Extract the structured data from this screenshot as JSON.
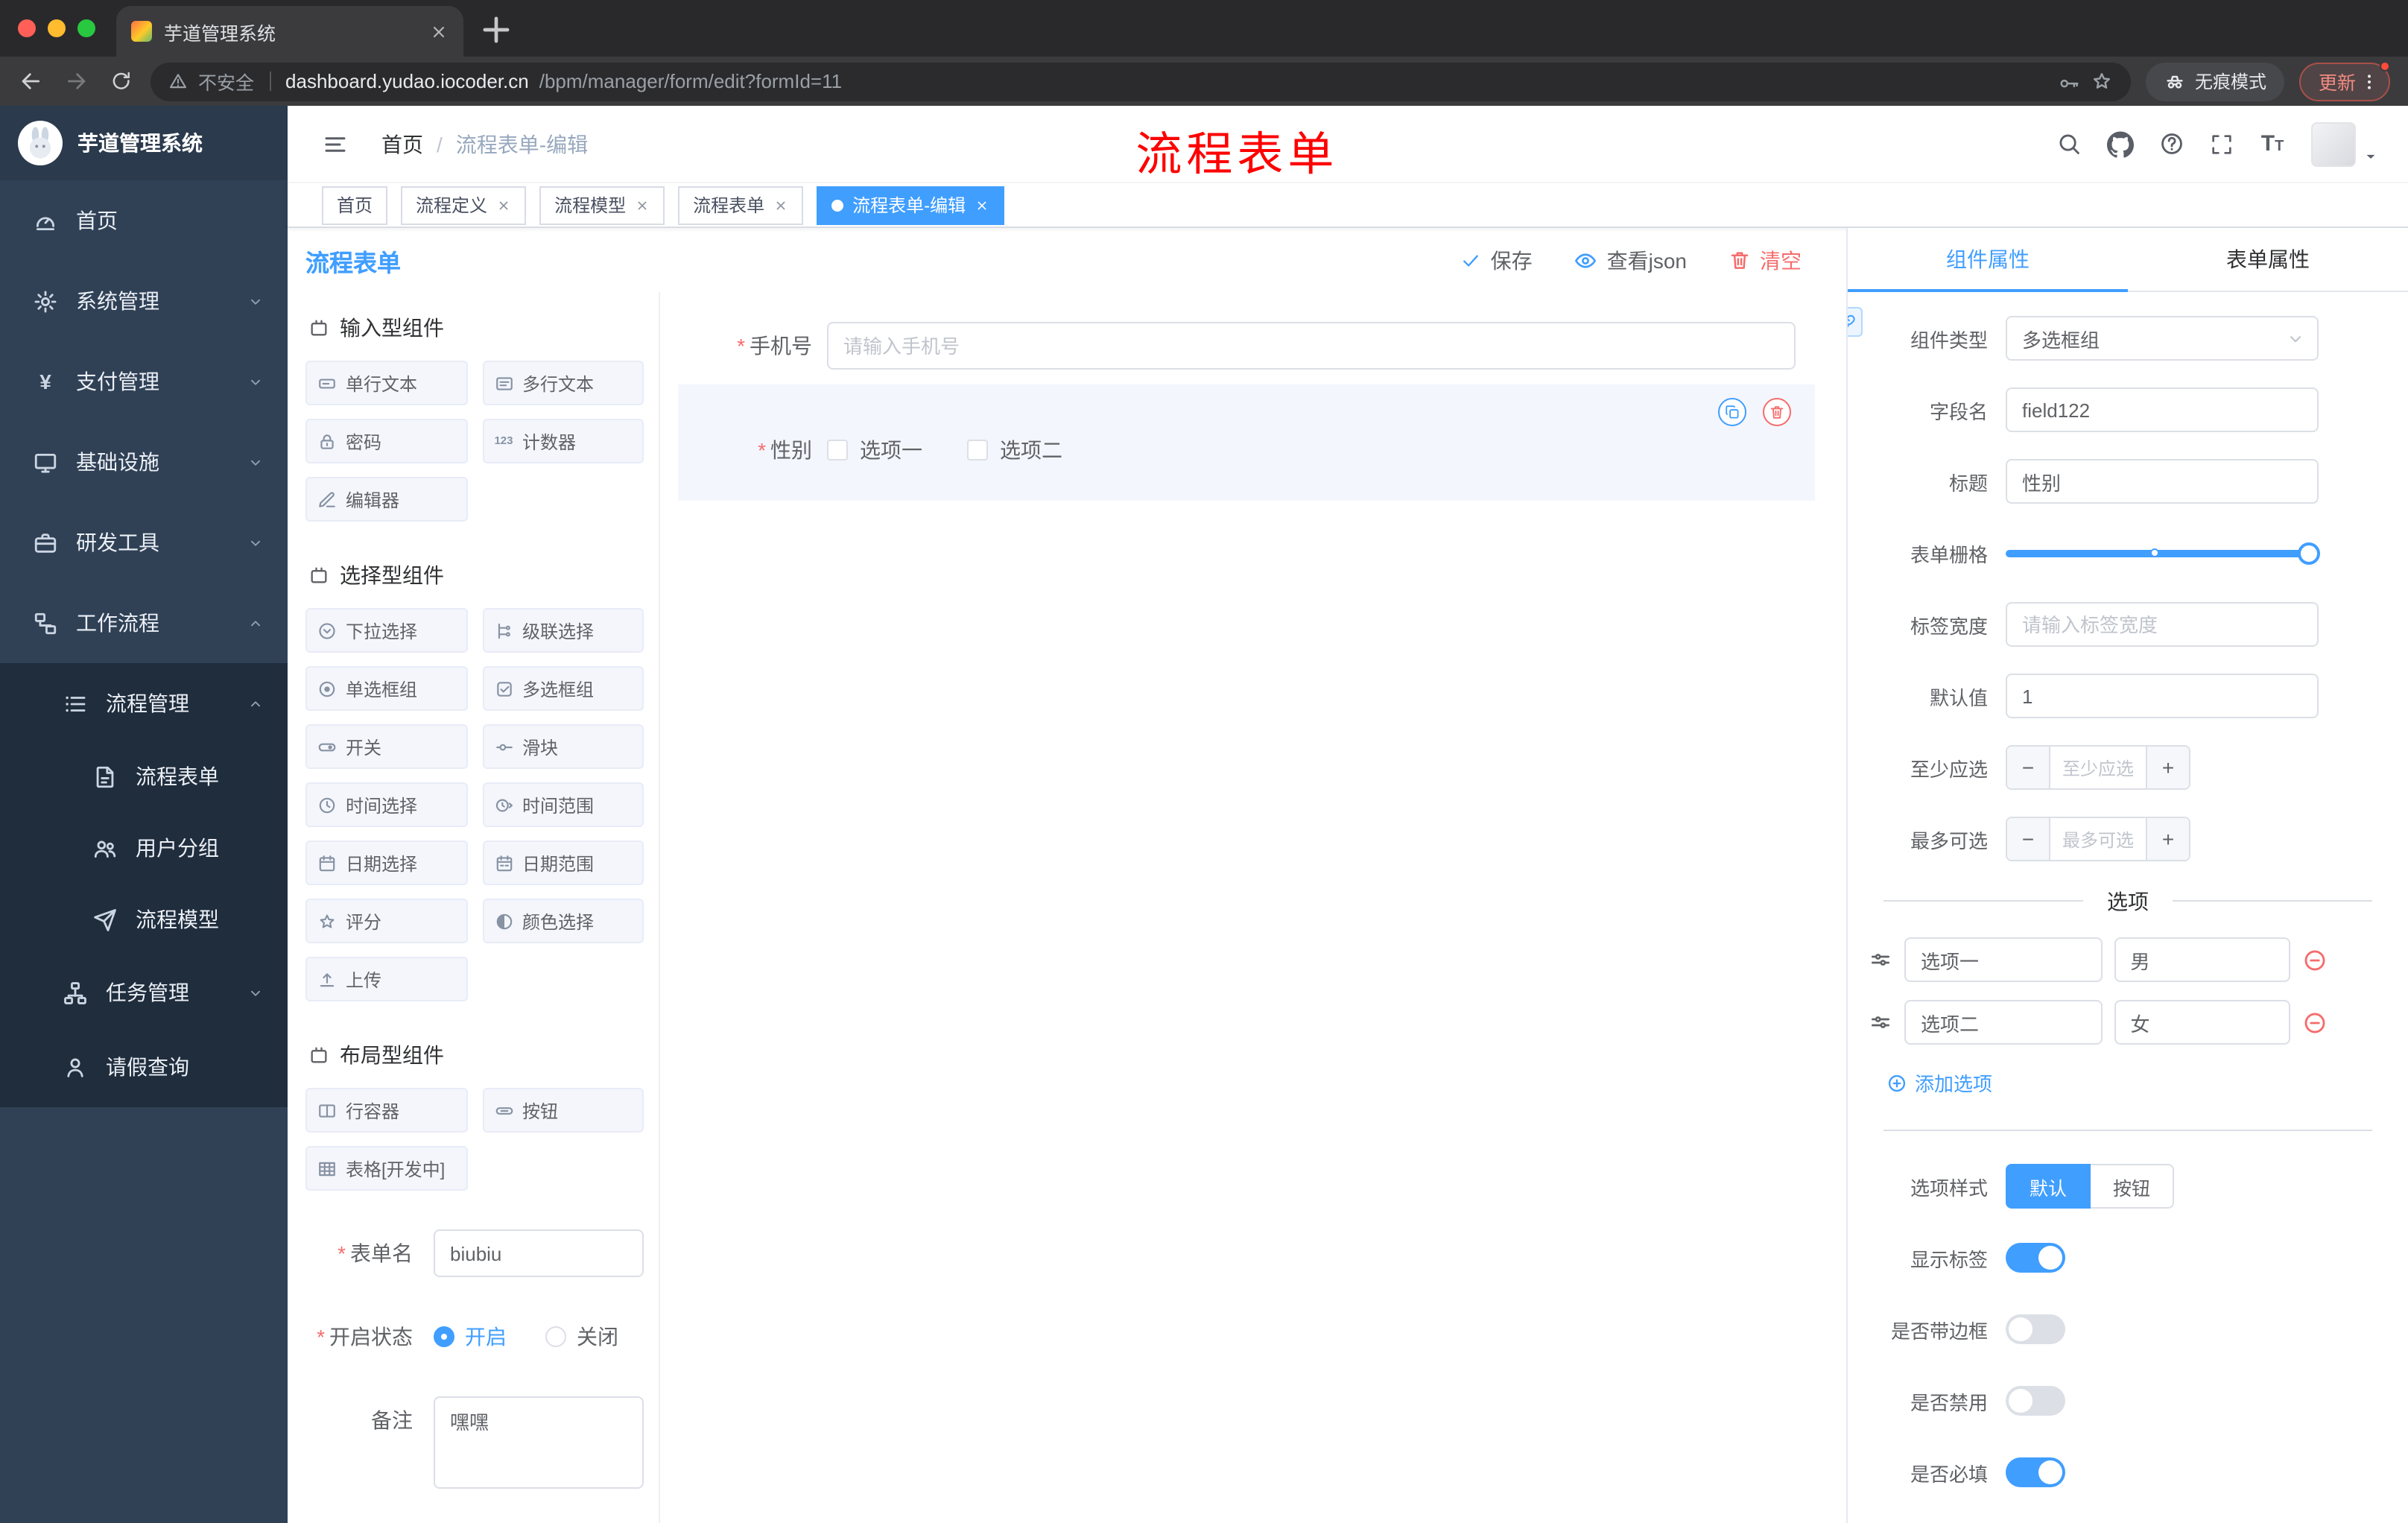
{
  "browser": {
    "tab_title": "芋道管理系统",
    "security_label": "不安全",
    "url_domain": "dashboard.yudao.iocoder.cn",
    "url_path": "/bpm/manager/form/edit?formId=11",
    "incognito_label": "无痕模式",
    "update_label": "更新"
  },
  "sidebar": {
    "logo_title": "芋道管理系统",
    "items": [
      {
        "label": "首页",
        "icon": "dashboard"
      },
      {
        "label": "系统管理",
        "icon": "gear"
      },
      {
        "label": "支付管理",
        "icon": "yen"
      },
      {
        "label": "基础设施",
        "icon": "monitor"
      },
      {
        "label": "研发工具",
        "icon": "toolbox"
      },
      {
        "label": "工作流程",
        "icon": "workflow"
      }
    ],
    "workflow": {
      "process_mgmt": {
        "label": "流程管理",
        "icon": "list"
      },
      "children": [
        {
          "label": "流程表单",
          "icon": "form"
        },
        {
          "label": "用户分组",
          "icon": "users"
        },
        {
          "label": "流程模型",
          "icon": "plane"
        }
      ],
      "task_mgmt": {
        "label": "任务管理",
        "icon": "sitemap"
      },
      "leave_query": {
        "label": "请假查询",
        "icon": "person"
      }
    }
  },
  "navbar": {
    "breadcrumb_home": "首页",
    "breadcrumb_current": "流程表单-编辑",
    "annotation": "流程表单"
  },
  "tags": [
    {
      "label": "首页"
    },
    {
      "label": "流程定义"
    },
    {
      "label": "流程模型"
    },
    {
      "label": "流程表单"
    },
    {
      "label": "流程表单-编辑"
    }
  ],
  "editor": {
    "title": "流程表单",
    "save": "保存",
    "view_json": "查看json",
    "clear": "清空",
    "palette": {
      "groups": [
        {
          "title": "输入型组件",
          "icon": "component-icon",
          "items": [
            {
              "label": "单行文本",
              "icon": "text-field"
            },
            {
              "label": "多行文本",
              "icon": "textarea"
            },
            {
              "label": "密码",
              "icon": "lock"
            },
            {
              "label": "计数器",
              "icon": "counter"
            },
            {
              "label": "编辑器",
              "icon": "editor"
            }
          ]
        },
        {
          "title": "选择型组件",
          "icon": "component-icon",
          "items": [
            {
              "label": "下拉选择",
              "icon": "select"
            },
            {
              "label": "级联选择",
              "icon": "cascader"
            },
            {
              "label": "单选框组",
              "icon": "radio"
            },
            {
              "label": "多选框组",
              "icon": "checkbox"
            },
            {
              "label": "开关",
              "icon": "switch"
            },
            {
              "label": "滑块",
              "icon": "slider"
            },
            {
              "label": "时间选择",
              "icon": "time"
            },
            {
              "label": "时间范围",
              "icon": "time-range"
            },
            {
              "label": "日期选择",
              "icon": "date"
            },
            {
              "label": "日期范围",
              "icon": "date-range"
            },
            {
              "label": "评分",
              "icon": "rate"
            },
            {
              "label": "颜色选择",
              "icon": "color"
            },
            {
              "label": "上传",
              "icon": "upload"
            }
          ]
        },
        {
          "title": "布局型组件",
          "icon": "component-icon",
          "items": [
            {
              "label": "行容器",
              "icon": "row"
            },
            {
              "label": "按钮",
              "icon": "button"
            },
            {
              "label": "表格[开发中]",
              "icon": "table"
            }
          ]
        }
      ]
    },
    "meta": {
      "name_label": "表单名",
      "name_value": "biubiu",
      "status_label": "开启状态",
      "status_on": "开启",
      "status_off": "关闭",
      "remark_label": "备注",
      "remark_value": "嘿嘿"
    },
    "canvas": {
      "phone_label": "手机号",
      "phone_placeholder": "请输入手机号",
      "gender_label": "性别",
      "gender_opt1": "选项一",
      "gender_opt2": "选项二"
    }
  },
  "props": {
    "tab_component": "组件属性",
    "tab_form": "表单属性",
    "component_type_label": "组件类型",
    "component_type_value": "多选框组",
    "field_name_label": "字段名",
    "field_name_value": "field122",
    "title_label": "标题",
    "title_value": "性别",
    "grid_label": "表单栅格",
    "label_width_label": "标签宽度",
    "label_width_placeholder": "请输入标签宽度",
    "default_label": "默认值",
    "default_value": "1",
    "min_label": "至少应选",
    "min_placeholder": "至少应选",
    "max_label": "最多可选",
    "max_placeholder": "最多可选",
    "options_title": "选项",
    "options": [
      {
        "label": "选项一",
        "value": "男"
      },
      {
        "label": "选项二",
        "value": "女"
      }
    ],
    "add_option": "添加选项",
    "style_label": "选项样式",
    "style_default": "默认",
    "style_button": "按钮",
    "show_label": "显示标签",
    "border_label": "是否带边框",
    "disabled_label": "是否禁用",
    "required_label": "是否必填"
  },
  "colors": {
    "accent": "#409eff",
    "danger": "#f56c6c",
    "sidebar": "#304156"
  }
}
